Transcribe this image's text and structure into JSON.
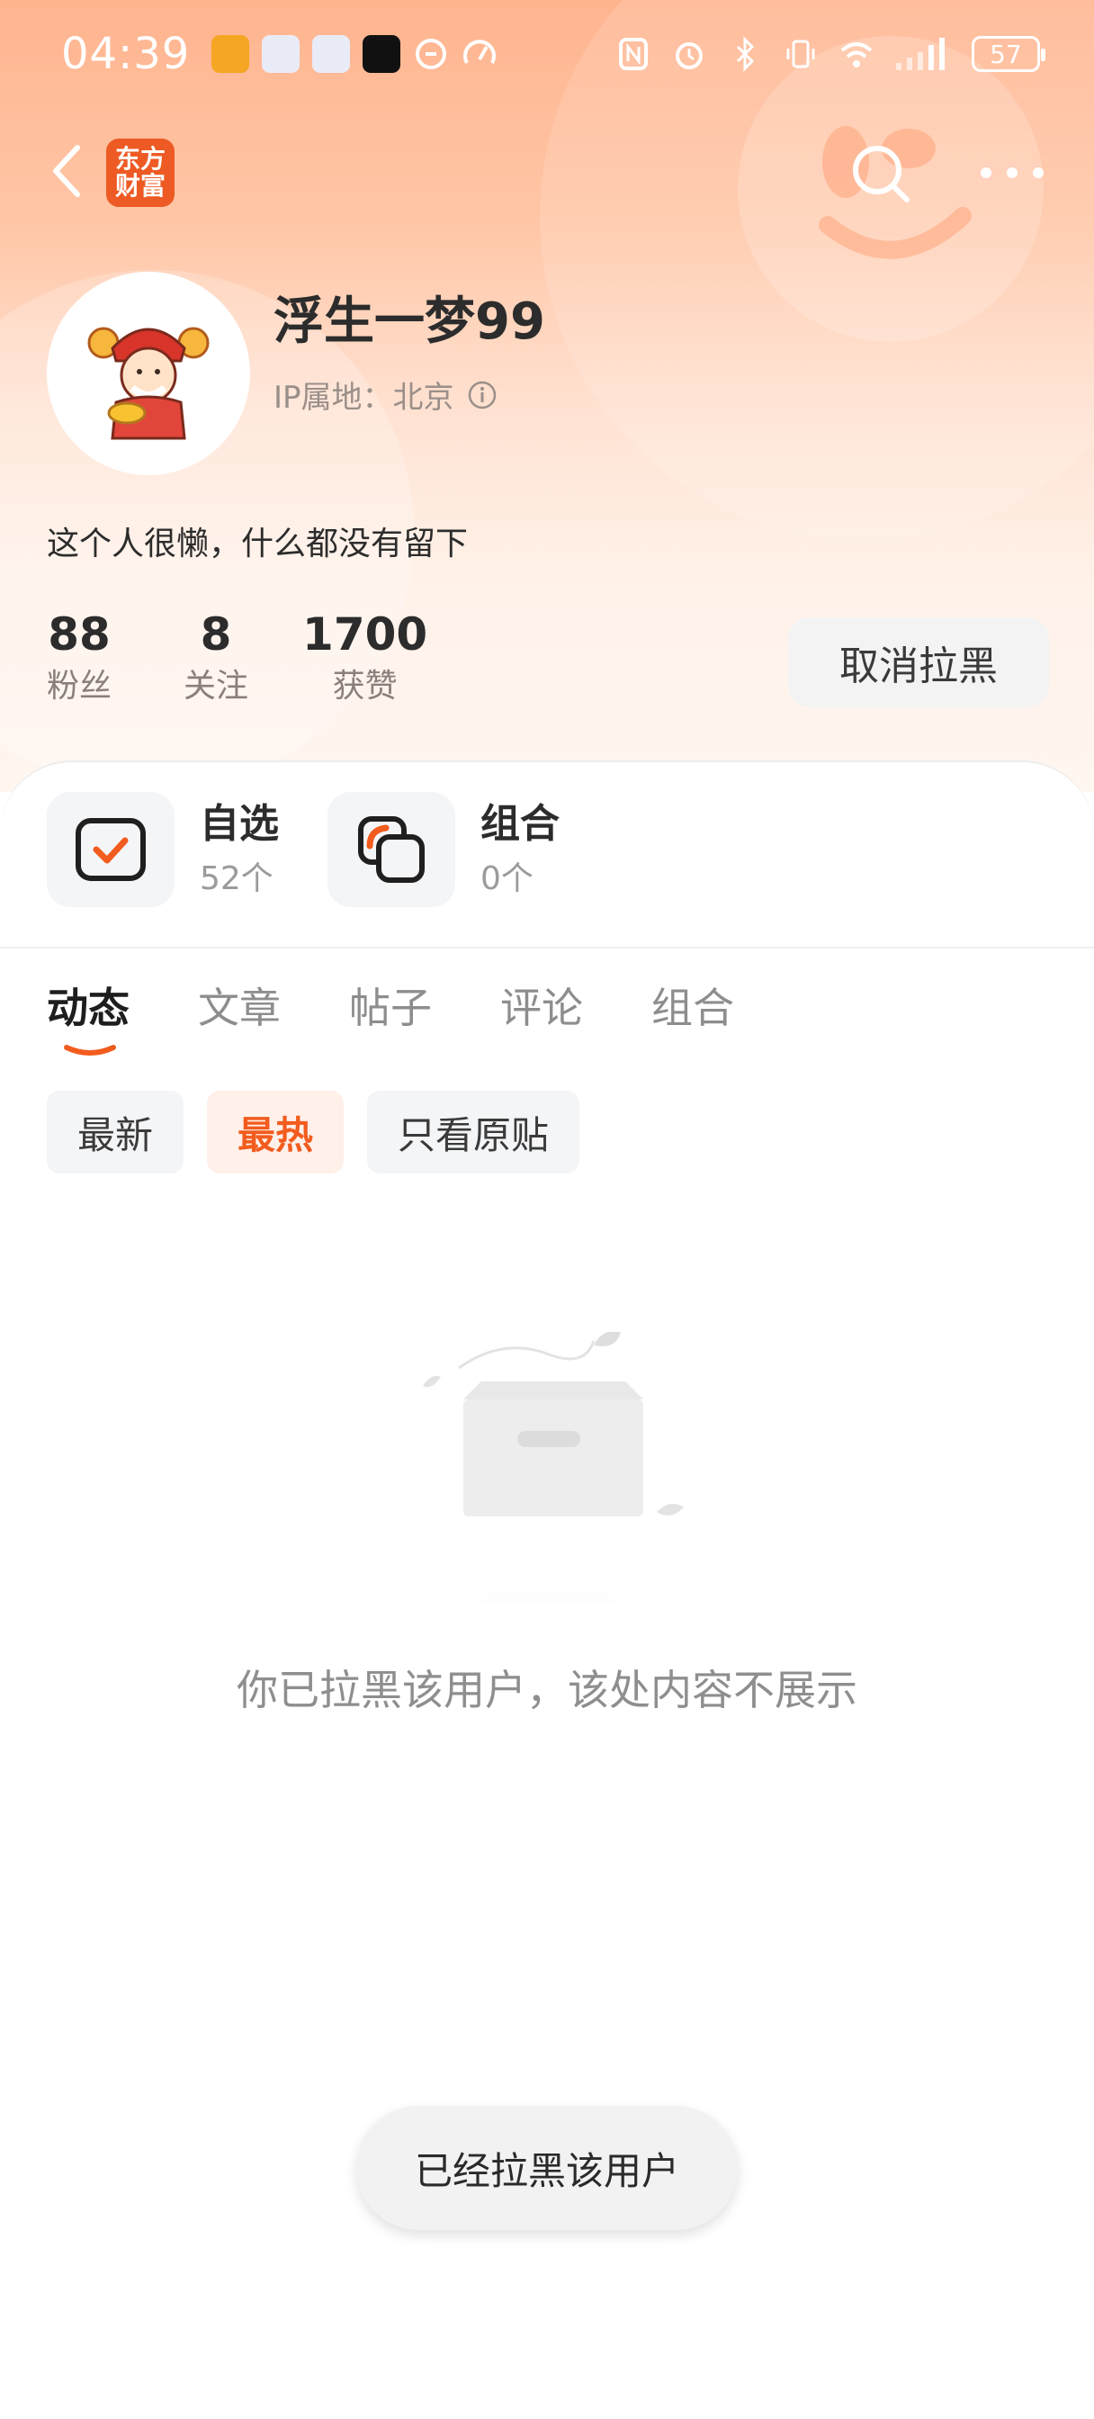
{
  "status_bar": {
    "time": "04:39",
    "battery": "57"
  },
  "nav": {
    "brand_line1": "东方",
    "brand_line2": "财富"
  },
  "profile": {
    "username": "浮生一梦99",
    "ip_location": "IP属地：北京",
    "bio": "这个人很懒，什么都没有留下"
  },
  "stats": [
    {
      "value": "88",
      "label": "粉丝"
    },
    {
      "value": "8",
      "label": "关注"
    },
    {
      "value": "1700",
      "label": "获赞"
    }
  ],
  "unblock_button": "取消拉黑",
  "quick": [
    {
      "title": "自选",
      "count": "52个"
    },
    {
      "title": "组合",
      "count": "0个"
    }
  ],
  "tabs": [
    {
      "label": "动态",
      "active": true
    },
    {
      "label": "文章",
      "active": false
    },
    {
      "label": "帖子",
      "active": false
    },
    {
      "label": "评论",
      "active": false
    },
    {
      "label": "组合",
      "active": false
    }
  ],
  "filters": [
    {
      "label": "最新",
      "active": false
    },
    {
      "label": "最热",
      "active": true
    },
    {
      "label": "只看原贴",
      "active": false
    }
  ],
  "empty_message": "你已拉黑该用户，该处内容不展示",
  "toast": "已经拉黑该用户",
  "colors": {
    "accent": "#f25c1e",
    "brand": "#ee5a24",
    "header_gradient_top": "#ffb48f"
  },
  "icons": {
    "back": "chevron-left-icon",
    "search": "search-icon",
    "more": "more-dots-icon",
    "info": "info-icon",
    "watchlist": "checkbox-icon",
    "portfolio": "stack-icon"
  }
}
